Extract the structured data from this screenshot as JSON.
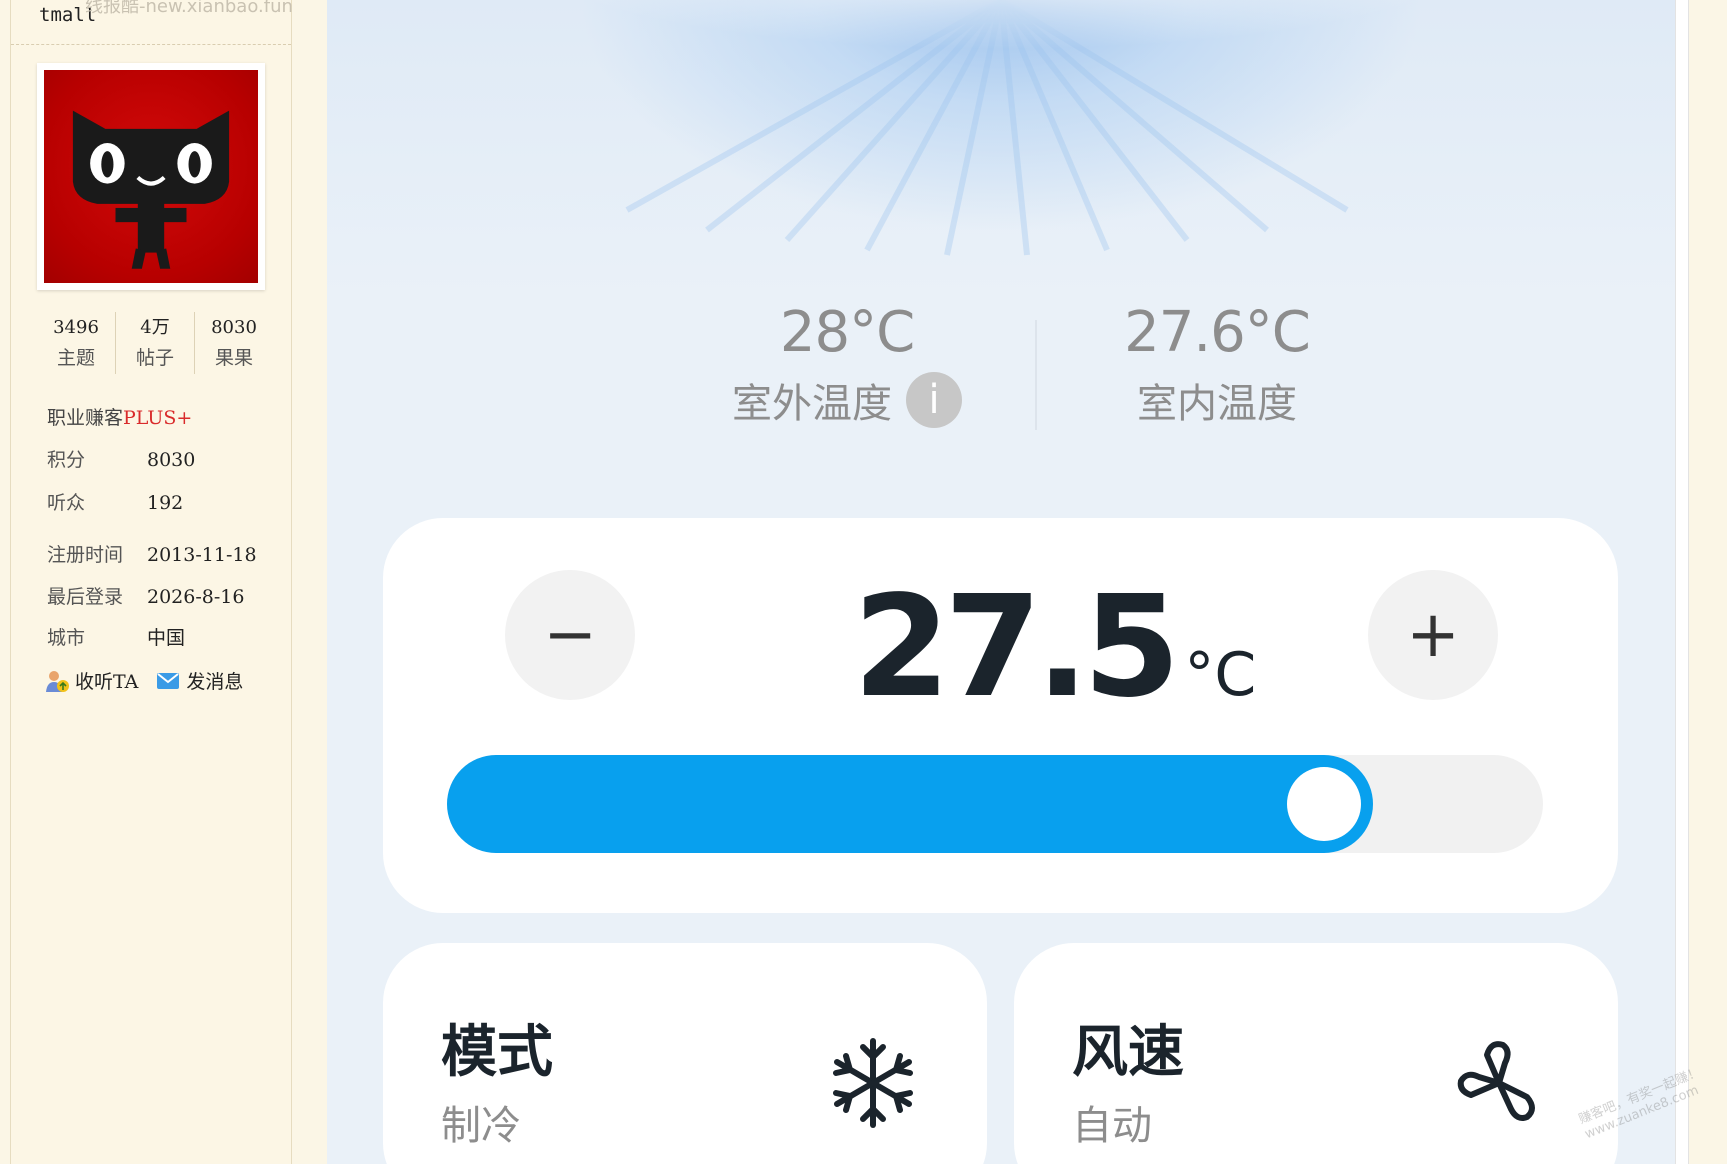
{
  "sidebar": {
    "username": "tmall",
    "watermark": "线报酷-new.xianbao.fun",
    "stats": [
      {
        "num": "3496",
        "label": "主题"
      },
      {
        "num": "4万",
        "label": "帖子"
      },
      {
        "num": "8030",
        "label": "果果"
      }
    ],
    "rank_label": "职业赚客",
    "rank_badge": "PLUS+",
    "points_label": "积分",
    "points_value": "8030",
    "listeners_label": "听众",
    "listeners_value": "192",
    "register_label": "注册时间",
    "register_value": "2013-11-18",
    "last_login_label": "最后登录",
    "last_login_value": "2026-8-16",
    "city_label": "城市",
    "city_value": "中国",
    "follow_label": "收听TA",
    "message_label": "发消息"
  },
  "app": {
    "outdoor_temp": "28°C",
    "outdoor_label": "室外温度",
    "info_icon_glyph": "i",
    "indoor_temp": "27.6°C",
    "indoor_label": "室内温度",
    "minus_glyph": "−",
    "plus_glyph": "+",
    "set_temp": "27.5",
    "set_unit": "°C",
    "slider_fraction": 0.8,
    "mode_title": "模式",
    "mode_value": "制冷",
    "fan_title": "风速",
    "fan_value": "自动",
    "accent_color": "#08a0ee"
  },
  "watermark_br": [
    "赚客吧，有奖一起赚！",
    "www.zuanke8.com"
  ]
}
